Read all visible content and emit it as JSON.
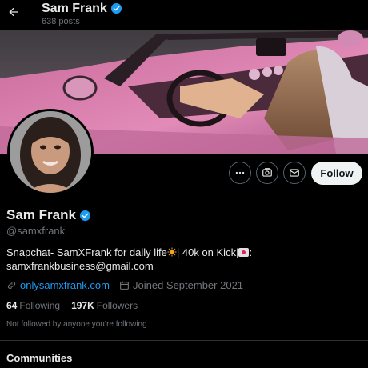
{
  "header": {
    "name": "Sam Frank",
    "posts": "638 posts"
  },
  "profile": {
    "name": "Sam Frank",
    "handle": "@samxfrank",
    "bio_line1": "Snapchat- SamXFrank for daily life",
    "bio_line1b": "| 40k on Kick|",
    "bio_line1c": ":",
    "bio_line2": "samxfrankbusiness@gmail.com",
    "website": "onlysamxfrank.com",
    "joined": "Joined September 2021",
    "following_count": "64",
    "following_label": "Following",
    "followers_count": "197K",
    "followers_label": "Followers",
    "not_followed": "Not followed by anyone you’re following"
  },
  "actions": {
    "follow_label": "Follow"
  },
  "sections": {
    "communities": "Communities"
  },
  "colors": {
    "accent": "#1d9bf0",
    "background": "#000000",
    "muted": "#71767b",
    "follow_bg": "#eff3f4"
  },
  "icons": [
    "back-arrow-icon",
    "verified-badge-icon",
    "more-icon",
    "subscribe-icon",
    "message-icon",
    "link-icon",
    "calendar-icon"
  ]
}
